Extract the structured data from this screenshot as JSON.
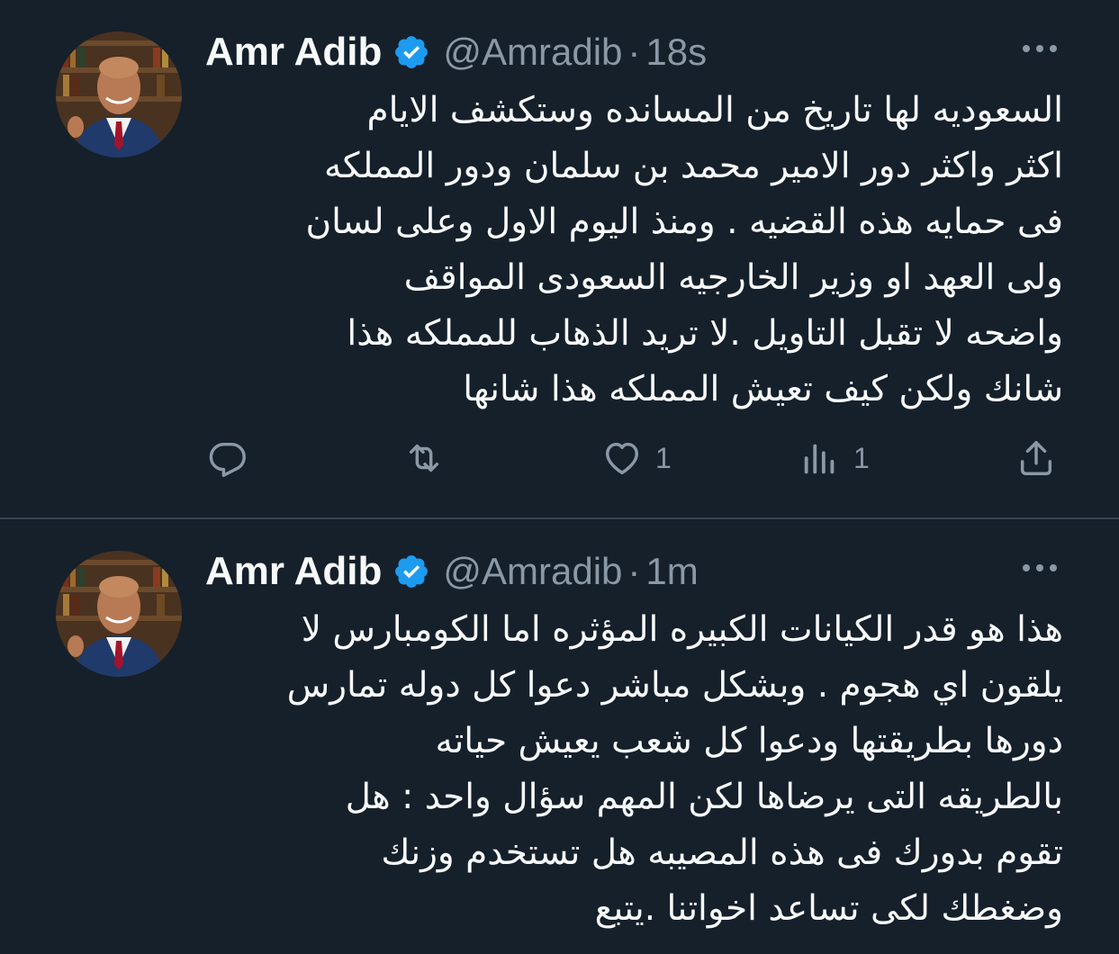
{
  "tweets": [
    {
      "author_name": "Amr Adib",
      "handle": "@Amradib",
      "separator": "·",
      "time": "18s",
      "text_lines": [
        "السعوديه لها تاريخ من المسانده وستكشف  الايام",
        "اكثر واكثر دور الامير محمد بن سلمان ودور المملكه",
        "فى حمايه هذه القضيه . ومنذ اليوم الاول وعلى لسان",
        "ولى العهد او وزير الخارجيه السعودى المواقف",
        "واضحه لا تقبل التاويل .لا تريد الذهاب للمملكه هذا",
        "شانك ولكن كيف تعيش المملكه هذا شانها"
      ],
      "likes": "1",
      "views": "1"
    },
    {
      "author_name": "Amr Adib",
      "handle": "@Amradib",
      "separator": "·",
      "time": "1m",
      "text_lines": [
        "هذا هو قدر الكيانات الكبيره المؤثره اما الكومبارس لا",
        "يلقون اي هجوم  . وبشكل مباشر دعوا كل دوله تمارس",
        "دورها بطريقتها ودعوا كل شعب يعيش حياته",
        "بالطريقه التى يرضاها لكن المهم سؤال واحد : هل",
        "تقوم بدورك فى هذه المصيبه هل تستخدم وزنك",
        "وضغطك لكى تساعد اخواتنا .يتبع"
      ]
    }
  ],
  "icons": {
    "verified": "verified-badge-icon",
    "more": "more-options-icon",
    "reply": "reply-icon",
    "retweet": "retweet-icon",
    "like": "heart-icon",
    "views": "analytics-icon",
    "share": "share-icon"
  },
  "colors": {
    "background": "#15202b",
    "text": "#f7f9f9",
    "secondary_text": "#8b98a5",
    "verified_blue": "#1d9bf0",
    "divider": "#38444d"
  }
}
